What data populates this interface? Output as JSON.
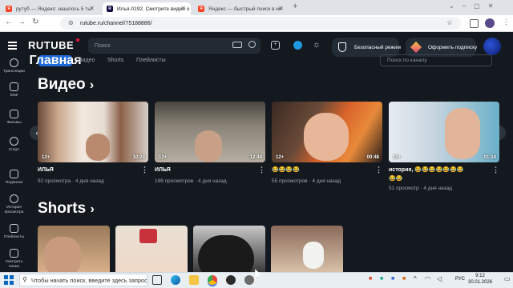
{
  "browser": {
    "tabs": [
      {
        "label": "рутуб — Яндекс: нашлось 5 ты",
        "favicon": "yandex-icon",
        "color": "#fc3f1d"
      },
      {
        "label": "Илья-0192. Смотрите видео о",
        "favicon": "rutube-icon",
        "color": "#100943",
        "active": true
      },
      {
        "label": "Яндекс — быстрый поиск в ин",
        "favicon": "yandex-icon",
        "color": "#fc3f1d"
      }
    ],
    "url": "rutube.ru/channel/75188886/"
  },
  "header": {
    "logo": "RUTUBE",
    "search_placeholder": "Поиск",
    "safe_mode": "Безопасный режим",
    "subscribe": "Оформить подписку"
  },
  "sidebar": {
    "items": [
      {
        "label": "Трансляции",
        "icon": "broadcast-icon"
      },
      {
        "label": "Моё",
        "icon": "my-icon"
      },
      {
        "label": "Фильмы",
        "icon": "films-icon"
      },
      {
        "label": "Спорт",
        "icon": "sport-icon"
      },
      {
        "label": "Подписки",
        "icon": "subscriptions-icon"
      },
      {
        "label": "История просмотра",
        "icon": "history-icon"
      },
      {
        "label": "Плейлисты",
        "icon": "playlists-icon"
      },
      {
        "label": "Смотреть позже",
        "icon": "watch-later-icon"
      }
    ]
  },
  "channel": {
    "tabs": [
      "Главная",
      "Видео",
      "Shorts",
      "Плейлисты"
    ],
    "search_placeholder": "Поиск по каналу"
  },
  "videos": {
    "title": "Видео",
    "items": [
      {
        "title": "ИЛЬЯ",
        "views": "92 просмотра",
        "date": "4 дня назад",
        "duration": "10:24",
        "age": "12+"
      },
      {
        "title": "ИЛЬЯ",
        "views": "198 просмотров",
        "date": "4 дня назад",
        "duration": "12:44",
        "age": "12+"
      },
      {
        "title": "😂😂😂😂",
        "views": "55 просмотров",
        "date": "4 дня назад",
        "duration": "00:48",
        "age": "12+"
      },
      {
        "title": "история, 😂😂😂😂😂😂😂",
        "title2": "😂😂",
        "views": "51 просмотр",
        "date": "4 дня назад",
        "duration": "01:14",
        "age": "12+"
      }
    ]
  },
  "shorts": {
    "title": "Shorts"
  },
  "taskbar": {
    "search_placeholder": "Чтобы начать поиск, введите здесь запрос",
    "lang": "РУС",
    "time": "9:12",
    "date": "30.01.2026"
  }
}
